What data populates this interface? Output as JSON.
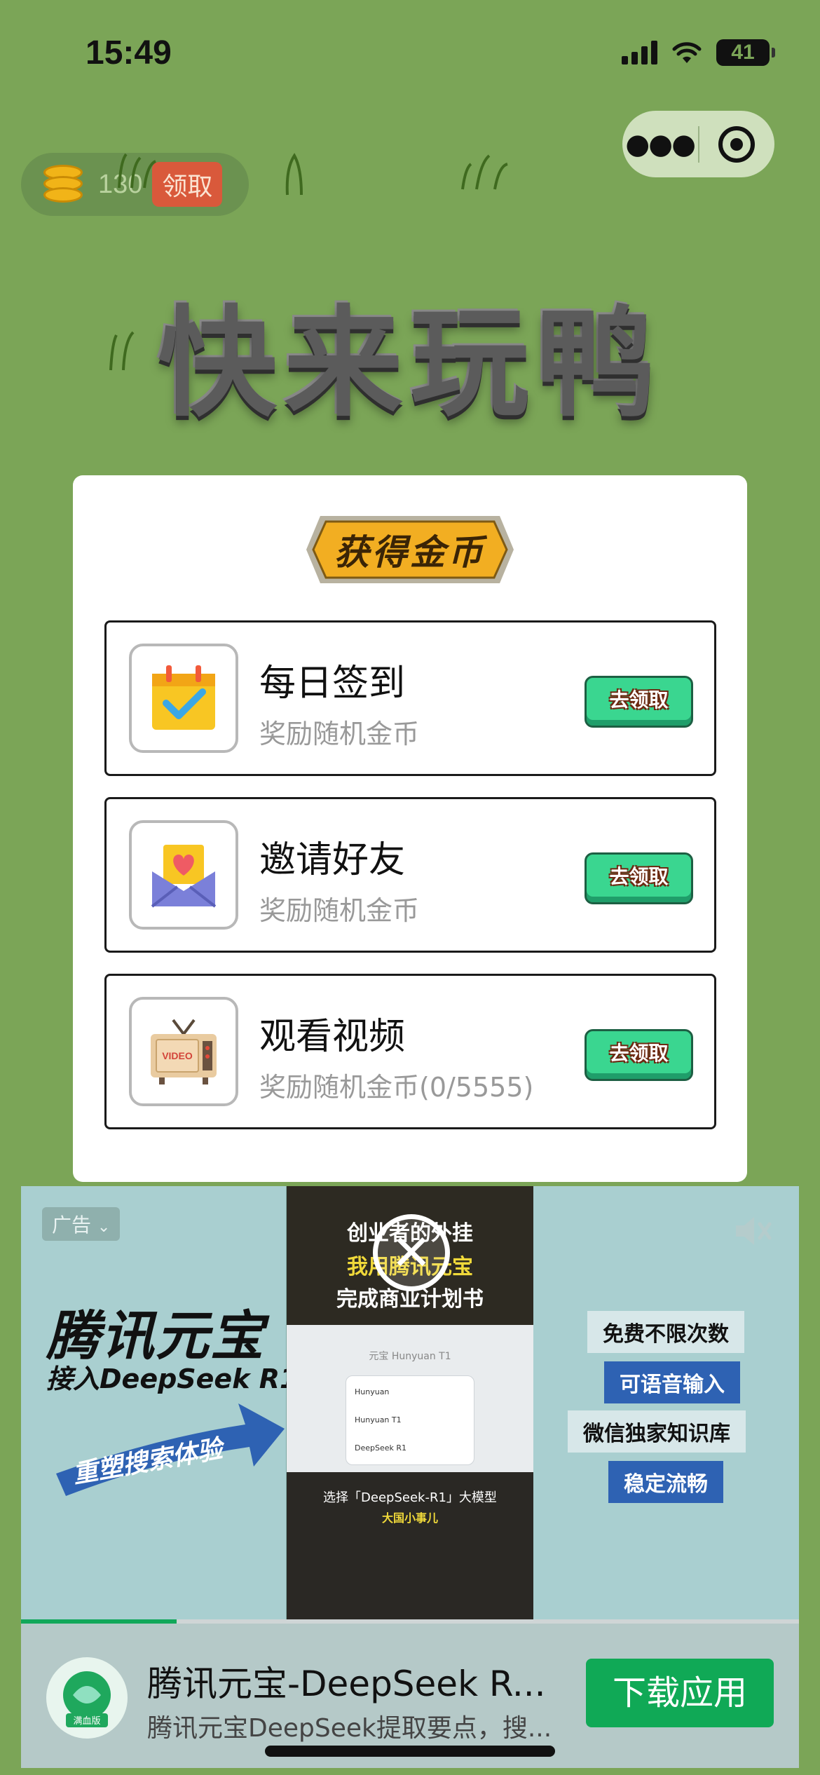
{
  "status_bar": {
    "time": "15:49",
    "battery": "41"
  },
  "coins": {
    "count": "130",
    "claim_label": "领取"
  },
  "game_title": "快来玩鸭",
  "panel": {
    "ribbon_title": "获得金币",
    "tasks": [
      {
        "title": "每日签到",
        "desc": "奖励随机金币",
        "button": "去领取",
        "icon": "calendar-check-icon"
      },
      {
        "title": "邀请好友",
        "desc": "奖励随机金币",
        "button": "去领取",
        "icon": "heart-envelope-icon"
      },
      {
        "title": "观看视频",
        "desc": "奖励随机金币(0/5555)",
        "button": "去领取",
        "icon": "video-tv-icon"
      }
    ]
  },
  "ad": {
    "label": "广告",
    "brand_title": "腾讯元宝",
    "brand_subtitle": "接入DeepSeek R1",
    "arrow_text": "重塑搜索体验",
    "video_lines": [
      "创业者的外挂",
      "我用腾讯元宝",
      "完成商业计划书"
    ],
    "video_card_title": "元宝 Hunyuan T1",
    "video_card_items": [
      "Hunyuan",
      "Hunyuan T1",
      "DeepSeek R1"
    ],
    "video_caption": "选择「DeepSeek-R1」大模型",
    "video_caption_sub": "大国小事儿",
    "features": [
      "免费不限次数",
      "可语音输入",
      "微信独家知识库",
      "稳定流畅"
    ],
    "progress": 0.2,
    "app_name": "腾讯元宝-DeepSeek R...",
    "app_desc": "腾讯元宝DeepSeek提取要点，搜...",
    "app_logo_text": "满血版",
    "download_label": "下载应用"
  }
}
